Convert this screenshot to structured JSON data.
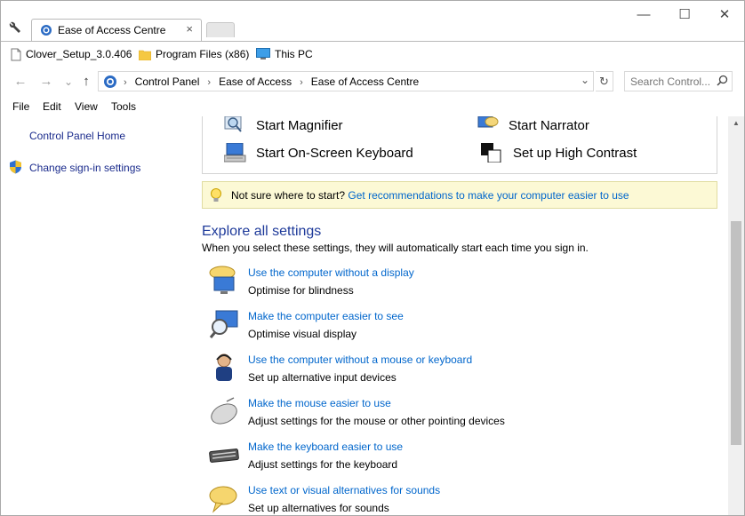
{
  "tab": {
    "title": "Ease of Access Centre",
    "close": "×"
  },
  "window_controls": {
    "minimize": "—",
    "maximize": "☐",
    "close": "✕"
  },
  "favorites": [
    {
      "label": "Clover_Setup_3.0.406",
      "icon": "file-icon"
    },
    {
      "label": "Program Files (x86)",
      "icon": "folder-icon"
    },
    {
      "label": "This PC",
      "icon": "monitor-icon"
    }
  ],
  "nav": {
    "back": "←",
    "forward": "→",
    "recent": "⌄",
    "up": "↑"
  },
  "address": {
    "crumbs": [
      "Control Panel",
      "Ease of Access",
      "Ease of Access Centre"
    ],
    "separator": "›",
    "dropdown": "⌄",
    "refresh": "↻"
  },
  "search": {
    "placeholder": "Search Control..."
  },
  "menu": [
    "File",
    "Edit",
    "View",
    "Tools"
  ],
  "left_pane": {
    "home": "Control Panel Home",
    "signin": "Change sign-in settings"
  },
  "quick_tools": {
    "magnifier": "Start Magnifier",
    "narrator": "Start Narrator",
    "keyboard": "Start On-Screen Keyboard",
    "contrast": "Set up High Contrast"
  },
  "tip": {
    "text": "Not sure where to start?",
    "link": "Get recommendations to make your computer easier to use"
  },
  "explore": {
    "title": "Explore all settings",
    "description": "When you select these settings, they will automatically start each time you sign in."
  },
  "settings": [
    {
      "link": "Use the computer without a display",
      "desc": "Optimise for blindness",
      "icon": "speech-display-icon"
    },
    {
      "link": "Make the computer easier to see",
      "desc": "Optimise visual display",
      "icon": "magnifier-display-icon"
    },
    {
      "link": "Use the computer without a mouse or keyboard",
      "desc": "Set up alternative input devices",
      "icon": "person-headset-icon"
    },
    {
      "link": "Make the mouse easier to use",
      "desc": "Adjust settings for the mouse or other pointing devices",
      "icon": "mouse-icon"
    },
    {
      "link": "Make the keyboard easier to use",
      "desc": "Adjust settings for the keyboard",
      "icon": "keyboard-icon"
    },
    {
      "link": "Use text or visual alternatives for sounds",
      "desc": "Set up alternatives for sounds",
      "icon": "speech-bubble-icon"
    }
  ],
  "colors": {
    "link": "#0066cc",
    "left_link": "#1a2b8c",
    "section_title": "#1e3a9a",
    "tip_bg": "#fcf9d5"
  }
}
